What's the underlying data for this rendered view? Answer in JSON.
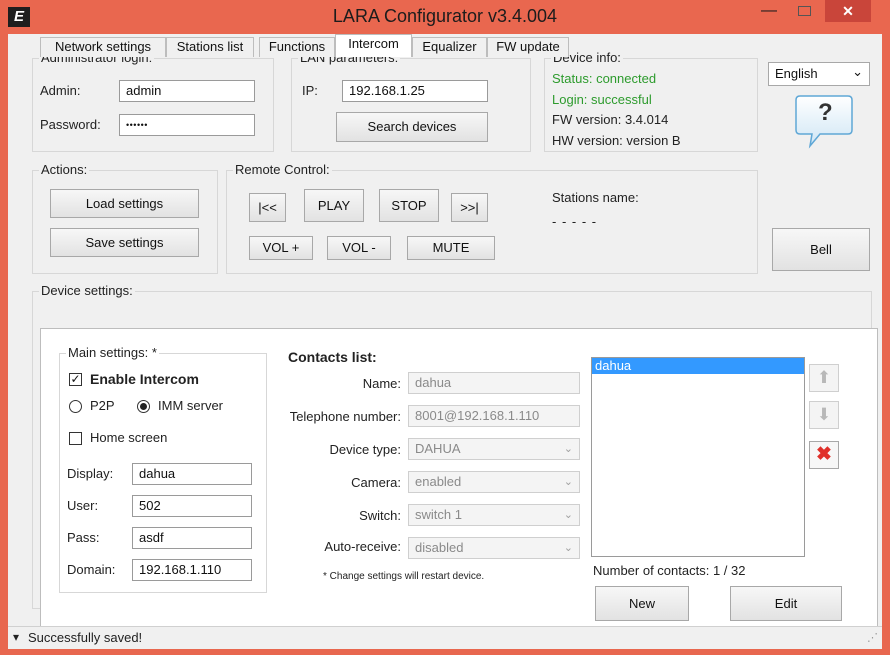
{
  "window": {
    "title": "LARA Configurator v3.4.004",
    "logo_text": "E",
    "min_glyph": "—",
    "close_glyph": "✕"
  },
  "admin": {
    "legend": "Administrator login:",
    "admin_label": "Admin:",
    "admin_value": "admin",
    "password_label": "Password:",
    "password_value": "••••••"
  },
  "lan": {
    "legend": "LAN parameters:",
    "ip_label": "IP:",
    "ip_value": "192.168.1.25",
    "search_button": "Search devices"
  },
  "device_info": {
    "legend": "Device info:",
    "status": "Status: connected",
    "login": "Login: successful",
    "fw": "FW version: 3.4.014",
    "hw": "HW version: version B"
  },
  "language": {
    "selected": "English",
    "arrow": "⌄"
  },
  "help": {
    "glyph": "?"
  },
  "actions": {
    "legend": "Actions:",
    "load": "Load settings",
    "save": "Save settings"
  },
  "remote": {
    "legend": "Remote Control:",
    "prev": "|<<",
    "play": "PLAY",
    "stop": "STOP",
    "next": ">>|",
    "vol_up": "VOL +",
    "vol_down": "VOL -",
    "mute": "MUTE",
    "stations_label": "Stations name:",
    "stations_value": "- - - - -"
  },
  "bell": {
    "label": "Bell"
  },
  "device_settings": {
    "legend": "Device settings:"
  },
  "tabs": [
    "Network settings",
    "Stations list",
    "Functions",
    "Intercom",
    "Equalizer",
    "FW update"
  ],
  "main_settings": {
    "legend": "Main settings: *",
    "enable_label": "Enable Intercom",
    "enable_checked": true,
    "check_glyph": "✓",
    "p2p_label": "P2P",
    "imm_label": "IMM server",
    "selected_mode": "IMM server",
    "home_label": "Home screen",
    "home_checked": false,
    "display_label": "Display:",
    "display_value": "dahua",
    "user_label": "User:",
    "user_value": "502",
    "pass_label": "Pass:",
    "pass_value": "asdf",
    "domain_label": "Domain:",
    "domain_value": "192.168.1.110"
  },
  "contacts": {
    "title": "Contacts list:",
    "name_label": "Name:",
    "name_value": "dahua",
    "tel_label": "Telephone number:",
    "tel_value": "8001@192.168.1.110",
    "type_label": "Device type:",
    "type_value": "DAHUA",
    "camera_label": "Camera:",
    "camera_value": "enabled",
    "switch_label": "Switch:",
    "switch_value": "switch 1",
    "auto_label": "Auto-receive:",
    "auto_value": "disabled",
    "dropdown_arrow": "⌄",
    "note": "* Change settings will restart device.",
    "list_items": [
      "dahua"
    ],
    "count_text": "Number of contacts: 1 / 32",
    "new_button": "New",
    "edit_button": "Edit",
    "up_glyph": "⬆",
    "down_glyph": "⬇",
    "delete_glyph": "✖"
  },
  "status": {
    "message": "Successfully saved!",
    "arrow": "▾",
    "grip": "⋰"
  },
  "colors": {
    "title_bar": "#e9674f",
    "status_green": "#2d9b2d",
    "selection": "#3399ff",
    "delete_red": "#e0302a"
  }
}
